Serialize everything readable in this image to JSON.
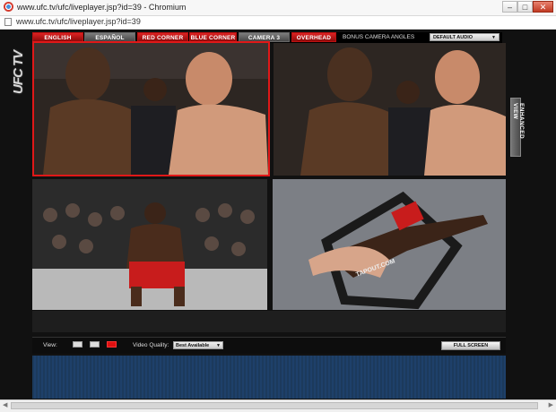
{
  "window": {
    "title": "www.ufc.tv/ufc/liveplayer.jsp?id=39 - Chromium",
    "controls": {
      "minimize": "–",
      "maximize": "□",
      "close": "✕"
    }
  },
  "address_bar": {
    "url": "www.ufc.tv/ufc/liveplayer.jsp?id=39"
  },
  "player": {
    "logo": "UFC TV",
    "camera_tabs": [
      {
        "label": "ENGLISH",
        "style": "red"
      },
      {
        "label": "ESPAÑOL",
        "style": "gray"
      },
      {
        "label": "RED CORNER",
        "style": "red"
      },
      {
        "label": "BLUE CORNER",
        "style": "red"
      },
      {
        "label": "CAMERA 3",
        "style": "gray"
      },
      {
        "label": "OVERHEAD",
        "style": "red"
      }
    ],
    "bonus_label": "BONUS CAMERA ANGLES",
    "audio_select": {
      "value": "DEFAULT AUDIO"
    },
    "enhanced_view_label": "ENHANCED VIEW",
    "controls": {
      "view_label": "View:",
      "video_quality_label": "Video Quality:",
      "video_quality_value": "Best Available",
      "fullscreen_label": "FULL SCREEN"
    }
  },
  "videos": [
    {
      "name": "main-feed",
      "selected": true
    },
    {
      "name": "camera-3"
    },
    {
      "name": "red-corner-cam"
    },
    {
      "name": "overhead-cam",
      "text": "TAPOUT.COM"
    }
  ],
  "colors": {
    "accent_red": "#d22222",
    "player_bg": "#111111",
    "blue_panel": "#1e406a"
  }
}
